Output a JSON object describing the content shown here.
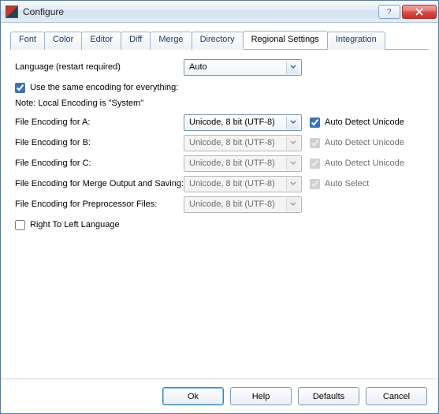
{
  "window": {
    "title": "Configure"
  },
  "tabs": {
    "font": "Font",
    "color": "Color",
    "editor": "Editor",
    "diff": "Diff",
    "merge": "Merge",
    "directory": "Directory",
    "regional": "Regional Settings",
    "integration": "Integration"
  },
  "labels": {
    "language": "Language (restart required)",
    "sameEncoding": "Use the same encoding for everything:",
    "note": "Note: Local Encoding is \"System\"",
    "encA": "File Encoding for A:",
    "encB": "File Encoding for B:",
    "encC": "File Encoding for C:",
    "encMerge": "File Encoding for Merge Output and Saving:",
    "encPre": "File Encoding for Preprocessor Files:",
    "rtl": "Right To Left Language",
    "autoDetect": "Auto Detect Unicode",
    "autoSelect": "Auto Select"
  },
  "values": {
    "language": "Auto",
    "encoding": "Unicode, 8 bit (UTF-8)"
  },
  "state": {
    "sameEncodingChecked": true,
    "autoDetectAChecked": true,
    "autoDetectBChecked": true,
    "autoDetectCChecked": true,
    "autoSelectChecked": true,
    "rtlChecked": false
  },
  "buttons": {
    "ok": "Ok",
    "help": "Help",
    "defaults": "Defaults",
    "cancel": "Cancel"
  }
}
